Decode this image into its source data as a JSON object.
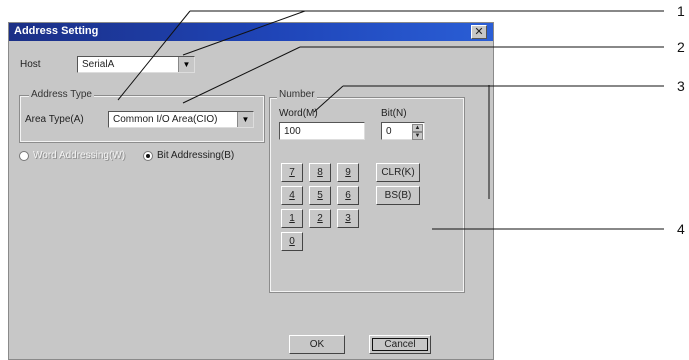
{
  "dialog": {
    "title": "Address Setting",
    "close_symbol": "✕"
  },
  "host": {
    "label": "Host",
    "value": "SerialA"
  },
  "address_type": {
    "legend": "Address Type",
    "area_type_label": "Area Type(A)",
    "area_type_value": "Common I/O Area(CIO)"
  },
  "addressing": {
    "word_option": "Word Addressing(W)",
    "word_selected": false,
    "bit_option": "Bit Addressing(B)",
    "bit_selected": true
  },
  "number": {
    "legend": "Number",
    "word_label": "Word(M)",
    "word_value": "100",
    "bit_label": "Bit(N)",
    "bit_value": "0"
  },
  "keypad": {
    "keys": [
      "7",
      "8",
      "9",
      "4",
      "5",
      "6",
      "1",
      "2",
      "3",
      "0"
    ],
    "clr_label": "CLR(K)",
    "bs_label": "BS(B)"
  },
  "buttons": {
    "ok": "OK",
    "cancel": "Cancel"
  },
  "callouts": [
    "1",
    "2",
    "3",
    "4"
  ]
}
